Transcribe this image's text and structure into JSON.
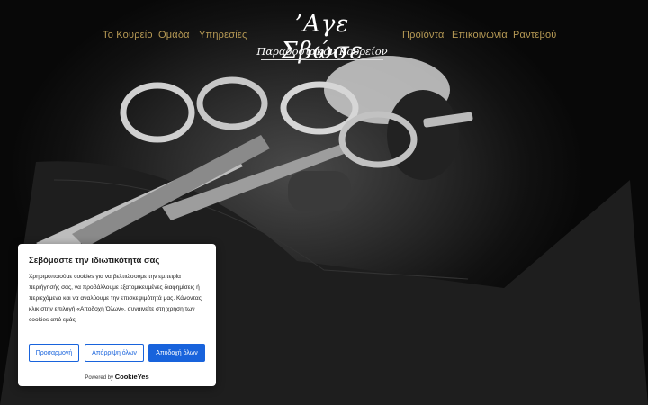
{
  "nav": {
    "left_links": [
      "Το Κουρείο",
      "Ομάδα",
      "Υπηρεσίες"
    ],
    "right_links": [
      "Προϊόντα",
      "Επικοινωνία",
      "Ραντεβού"
    ],
    "logo_title": "’Αγε Σβώσε",
    "logo_subtitle": "Παραδοσιακόν Κουρείον"
  },
  "cookie_banner": {
    "title": "Σεβόμαστε την ιδιωτικότητά σας",
    "text": "Χρησιμοποιούμε cookies για να βελτιώσουμε την εμπειρία περιήγησής σας, να προβάλλουμε εξατομικευμένες διαφημίσεις ή περιεχόμενο και να αναλύουμε την επισκεψιμότητά μας. Κάνοντας κλικ στην επιλογή «Αποδοχή Όλων», συναινείτε στη χρήση των cookies από εμάς.",
    "customize_label": "Προσαρμογή",
    "reject_label": "Απόρριψη όλων",
    "accept_label": "Αποδοχή όλων",
    "powered_by": "Powered by",
    "powered_brand": "CookieYes"
  },
  "colors": {
    "nav_link": "#b79a55",
    "accent": "#1863dc"
  }
}
